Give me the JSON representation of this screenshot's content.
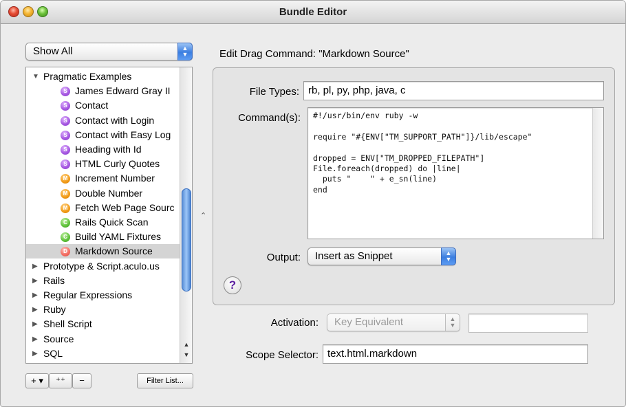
{
  "window": {
    "title": "Bundle Editor"
  },
  "left_panel": {
    "filter_popup": "Show All",
    "tree": [
      {
        "type": "folder",
        "label": "Pragmatic Examples",
        "open": true
      },
      {
        "type": "item",
        "icon": "S",
        "color": "purple",
        "label": "James Edward Gray II"
      },
      {
        "type": "item",
        "icon": "S",
        "color": "purple",
        "label": "Contact"
      },
      {
        "type": "item",
        "icon": "S",
        "color": "purple",
        "label": "Contact with Login"
      },
      {
        "type": "item",
        "icon": "S",
        "color": "purple",
        "label": "Contact with Easy Log"
      },
      {
        "type": "item",
        "icon": "S",
        "color": "purple",
        "label": "Heading with Id"
      },
      {
        "type": "item",
        "icon": "S",
        "color": "purple",
        "label": "HTML Curly Quotes"
      },
      {
        "type": "item",
        "icon": "M",
        "color": "orange",
        "label": "Increment Number"
      },
      {
        "type": "item",
        "icon": "M",
        "color": "orange",
        "label": "Double Number"
      },
      {
        "type": "item",
        "icon": "M",
        "color": "orange",
        "label": "Fetch Web Page Sourc"
      },
      {
        "type": "item",
        "icon": "C",
        "color": "green",
        "label": "Rails Quick Scan"
      },
      {
        "type": "item",
        "icon": "C",
        "color": "green",
        "label": "Build YAML Fixtures"
      },
      {
        "type": "item",
        "icon": "D",
        "color": "red",
        "label": "Markdown Source",
        "selected": true
      },
      {
        "type": "folder",
        "label": "Prototype & Script.aculo.us",
        "open": false
      },
      {
        "type": "folder",
        "label": "Rails",
        "open": false
      },
      {
        "type": "folder",
        "label": "Regular Expressions",
        "open": false
      },
      {
        "type": "folder",
        "label": "Ruby",
        "open": false
      },
      {
        "type": "folder",
        "label": "Shell Script",
        "open": false
      },
      {
        "type": "folder",
        "label": "Source",
        "open": false
      },
      {
        "type": "folder",
        "label": "SQL",
        "open": false
      }
    ],
    "buttons": {
      "add": "+ ▾",
      "add_item": "⁺⁺",
      "remove": "−",
      "filter_list": "Filter List..."
    }
  },
  "editor": {
    "heading": "Edit Drag Command: \"Markdown Source\"",
    "file_types_label": "File Types:",
    "file_types_value": "rb, pl, py, php, java, c",
    "command_label": "Command(s):",
    "command_text": "#!/usr/bin/env ruby -w\n\nrequire \"#{ENV[\"TM_SUPPORT_PATH\"]}/lib/escape\"\n\ndropped = ENV[\"TM_DROPPED_FILEPATH\"]\nFile.foreach(dropped) do |line|\n  puts \"    \" + e_sn(line)\nend",
    "output_label": "Output:",
    "output_value": "Insert as Snippet",
    "help": "?",
    "activation_label": "Activation:",
    "activation_value": "Key Equivalent",
    "activation_key": "",
    "scope_label": "Scope Selector:",
    "scope_value": "text.html.markdown"
  },
  "colors": {
    "window_bg": "#ececec",
    "selection": "#d4d4d4",
    "accent_blue": "#3b7ee0"
  }
}
